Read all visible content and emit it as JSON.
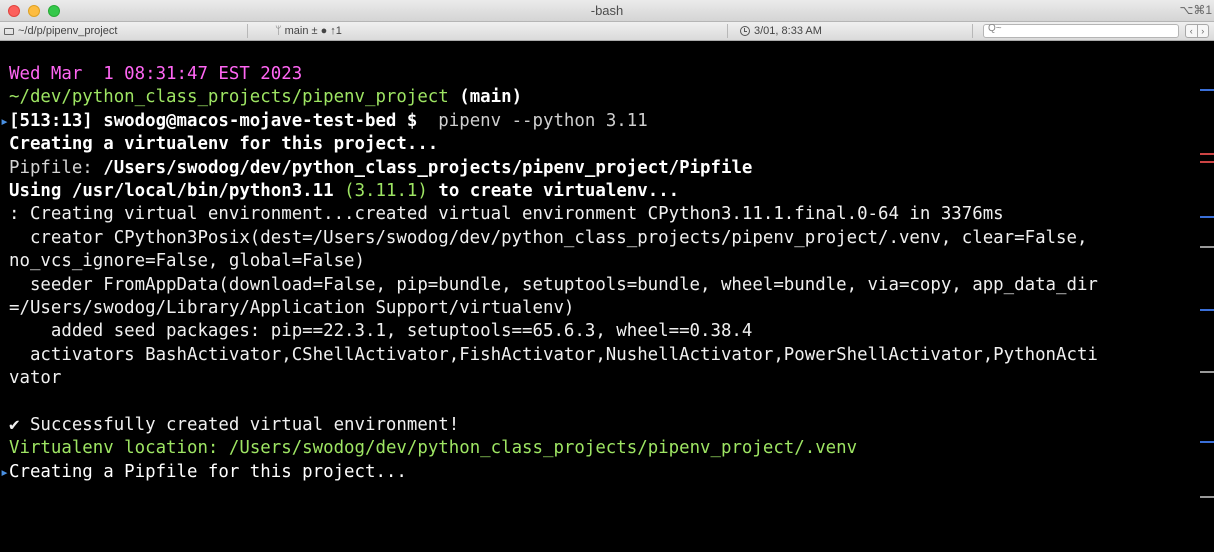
{
  "window": {
    "title": "-bash",
    "shortcut": "⌥⌘1"
  },
  "statusbar": {
    "path": "~/d/p/pipenv_project",
    "git": "main ± ● ↑1",
    "clock": "3/01, 8:33 AM",
    "search_placeholder": "Q~",
    "icons": [
      "folder-icon",
      "branch-icon",
      "clock-icon",
      "search-icon"
    ]
  },
  "terminal": {
    "date_line": "Wed Mar  1 08:31:47 EST 2023",
    "cwd": "~/dev/python_class_projects/pipenv_project",
    "branch": "(main)",
    "prompt": "[513:13] swodog@macos-mojave-test-bed $",
    "command": "pipenv --python 3.11",
    "l_creating": "Creating a virtualenv for this project...",
    "l_pipfile_label": "Pipfile:",
    "l_pipfile_path": "/Users/swodog/dev/python_class_projects/pipenv_project/Pipfile",
    "l_using_a": "Using",
    "l_using_path": "/usr/local/bin/python3.11",
    "l_using_version": "(3.11.1)",
    "l_using_b": "to create virtualenv...",
    "l_created": ": Creating virtual environment...created virtual environment CPython3.11.1.final.0-64 in 3376ms",
    "l_creator_1": "  creator CPython3Posix(dest=/Users/swodog/dev/python_class_projects/pipenv_project/.venv, clear=False,",
    "l_creator_2": "no_vcs_ignore=False, global=False)",
    "l_seeder_1": "  seeder FromAppData(download=False, pip=bundle, setuptools=bundle, wheel=bundle, via=copy, app_data_dir",
    "l_seeder_2": "=/Users/swodog/Library/Application Support/virtualenv)",
    "l_added": "    added seed packages: pip==22.3.1, setuptools==65.6.3, wheel==0.38.4",
    "l_activators_1": "  activators BashActivator,CShellActivator,FishActivator,NushellActivator,PowerShellActivator,PythonActi",
    "l_activators_2": "vator",
    "l_success": "✔ Successfully created virtual environment!",
    "l_location_label": "Virtualenv location:",
    "l_location_path": "/Users/swodog/dev/python_class_projects/pipenv_project/.venv",
    "l_pipfile_create": "Creating a Pipfile for this project..."
  },
  "colors": {
    "date": "#ff66f3",
    "path": "#9ee563",
    "prompt_mark": "#4a90e2"
  }
}
